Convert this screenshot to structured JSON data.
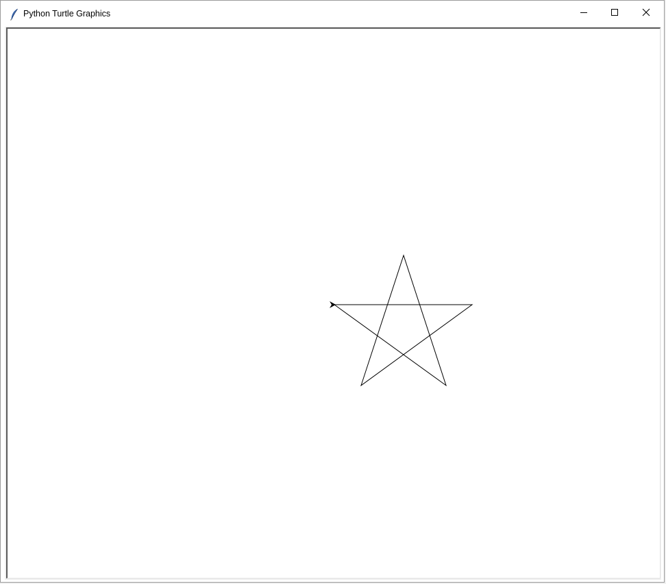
{
  "window": {
    "title": "Python Turtle Graphics",
    "app_icon": "tk-feather-icon"
  },
  "controls": {
    "minimize_icon": "minimize-icon",
    "maximize_icon": "maximize-icon",
    "close_icon": "close-icon"
  },
  "canvas": {
    "background": "#ffffff",
    "pen_color": "#000000",
    "drawing": "pentagram",
    "turtle_shape": "classic-arrow",
    "turtle_heading": "west"
  }
}
